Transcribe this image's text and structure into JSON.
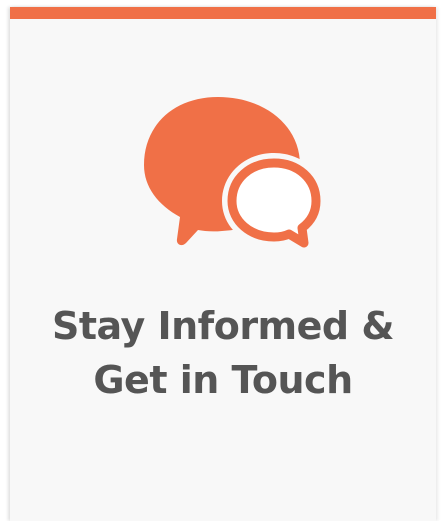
{
  "card": {
    "title_line1": "Stay Informed &",
    "title_line2": "Get in Touch",
    "icon": "chat-bubbles-icon"
  },
  "colors": {
    "accent": "#f07047",
    "title_text": "#555555",
    "card_background": "#f8f8f8"
  }
}
